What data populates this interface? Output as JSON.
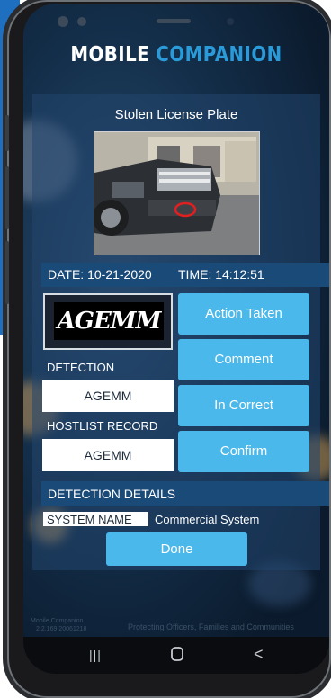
{
  "app": {
    "title_part1": "MOBILE",
    "title_part2": "COMPANION"
  },
  "alert": {
    "title": "Stolen License Plate"
  },
  "datetime": {
    "date": "DATE: 10-21-2020",
    "time": "TIME: 14:12:51"
  },
  "plate": {
    "text": "AGEMM"
  },
  "detection": {
    "label": "DETECTION",
    "value": "AGEMM"
  },
  "hotlist": {
    "label": "HOSTLIST RECORD",
    "value": "AGEMM"
  },
  "actions": {
    "action_taken": "Action Taken",
    "comment": "Comment",
    "incorrect": "In Correct",
    "confirm": "Confirm"
  },
  "details": {
    "header": "DETECTION DETAILS",
    "system_name_label": "SYSTEM NAME",
    "system_name_value": "Commercial System"
  },
  "done_label": "Done",
  "footer": {
    "app_name": "Mobile Companion",
    "version": "2.2.169.20061218",
    "tagline": "Protecting Officers, Families and Communities"
  },
  "navbar": {
    "recent": "|||",
    "home": "○",
    "back": "<"
  },
  "colors": {
    "accent": "#4ab8ea",
    "title_accent": "#2a9ad8",
    "bar": "#1a4a78"
  }
}
